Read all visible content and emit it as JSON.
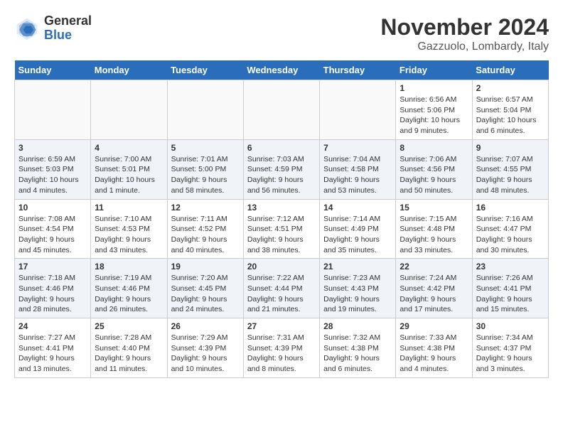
{
  "header": {
    "logo_general": "General",
    "logo_blue": "Blue",
    "month_title": "November 2024",
    "location": "Gazzuolo, Lombardy, Italy"
  },
  "weekdays": [
    "Sunday",
    "Monday",
    "Tuesday",
    "Wednesday",
    "Thursday",
    "Friday",
    "Saturday"
  ],
  "weeks": [
    [
      {
        "num": "",
        "info": ""
      },
      {
        "num": "",
        "info": ""
      },
      {
        "num": "",
        "info": ""
      },
      {
        "num": "",
        "info": ""
      },
      {
        "num": "",
        "info": ""
      },
      {
        "num": "1",
        "info": "Sunrise: 6:56 AM\nSunset: 5:06 PM\nDaylight: 10 hours and 9 minutes."
      },
      {
        "num": "2",
        "info": "Sunrise: 6:57 AM\nSunset: 5:04 PM\nDaylight: 10 hours and 6 minutes."
      }
    ],
    [
      {
        "num": "3",
        "info": "Sunrise: 6:59 AM\nSunset: 5:03 PM\nDaylight: 10 hours and 4 minutes."
      },
      {
        "num": "4",
        "info": "Sunrise: 7:00 AM\nSunset: 5:01 PM\nDaylight: 10 hours and 1 minute."
      },
      {
        "num": "5",
        "info": "Sunrise: 7:01 AM\nSunset: 5:00 PM\nDaylight: 9 hours and 58 minutes."
      },
      {
        "num": "6",
        "info": "Sunrise: 7:03 AM\nSunset: 4:59 PM\nDaylight: 9 hours and 56 minutes."
      },
      {
        "num": "7",
        "info": "Sunrise: 7:04 AM\nSunset: 4:58 PM\nDaylight: 9 hours and 53 minutes."
      },
      {
        "num": "8",
        "info": "Sunrise: 7:06 AM\nSunset: 4:56 PM\nDaylight: 9 hours and 50 minutes."
      },
      {
        "num": "9",
        "info": "Sunrise: 7:07 AM\nSunset: 4:55 PM\nDaylight: 9 hours and 48 minutes."
      }
    ],
    [
      {
        "num": "10",
        "info": "Sunrise: 7:08 AM\nSunset: 4:54 PM\nDaylight: 9 hours and 45 minutes."
      },
      {
        "num": "11",
        "info": "Sunrise: 7:10 AM\nSunset: 4:53 PM\nDaylight: 9 hours and 43 minutes."
      },
      {
        "num": "12",
        "info": "Sunrise: 7:11 AM\nSunset: 4:52 PM\nDaylight: 9 hours and 40 minutes."
      },
      {
        "num": "13",
        "info": "Sunrise: 7:12 AM\nSunset: 4:51 PM\nDaylight: 9 hours and 38 minutes."
      },
      {
        "num": "14",
        "info": "Sunrise: 7:14 AM\nSunset: 4:49 PM\nDaylight: 9 hours and 35 minutes."
      },
      {
        "num": "15",
        "info": "Sunrise: 7:15 AM\nSunset: 4:48 PM\nDaylight: 9 hours and 33 minutes."
      },
      {
        "num": "16",
        "info": "Sunrise: 7:16 AM\nSunset: 4:47 PM\nDaylight: 9 hours and 30 minutes."
      }
    ],
    [
      {
        "num": "17",
        "info": "Sunrise: 7:18 AM\nSunset: 4:46 PM\nDaylight: 9 hours and 28 minutes."
      },
      {
        "num": "18",
        "info": "Sunrise: 7:19 AM\nSunset: 4:46 PM\nDaylight: 9 hours and 26 minutes."
      },
      {
        "num": "19",
        "info": "Sunrise: 7:20 AM\nSunset: 4:45 PM\nDaylight: 9 hours and 24 minutes."
      },
      {
        "num": "20",
        "info": "Sunrise: 7:22 AM\nSunset: 4:44 PM\nDaylight: 9 hours and 21 minutes."
      },
      {
        "num": "21",
        "info": "Sunrise: 7:23 AM\nSunset: 4:43 PM\nDaylight: 9 hours and 19 minutes."
      },
      {
        "num": "22",
        "info": "Sunrise: 7:24 AM\nSunset: 4:42 PM\nDaylight: 9 hours and 17 minutes."
      },
      {
        "num": "23",
        "info": "Sunrise: 7:26 AM\nSunset: 4:41 PM\nDaylight: 9 hours and 15 minutes."
      }
    ],
    [
      {
        "num": "24",
        "info": "Sunrise: 7:27 AM\nSunset: 4:41 PM\nDaylight: 9 hours and 13 minutes."
      },
      {
        "num": "25",
        "info": "Sunrise: 7:28 AM\nSunset: 4:40 PM\nDaylight: 9 hours and 11 minutes."
      },
      {
        "num": "26",
        "info": "Sunrise: 7:29 AM\nSunset: 4:39 PM\nDaylight: 9 hours and 10 minutes."
      },
      {
        "num": "27",
        "info": "Sunrise: 7:31 AM\nSunset: 4:39 PM\nDaylight: 9 hours and 8 minutes."
      },
      {
        "num": "28",
        "info": "Sunrise: 7:32 AM\nSunset: 4:38 PM\nDaylight: 9 hours and 6 minutes."
      },
      {
        "num": "29",
        "info": "Sunrise: 7:33 AM\nSunset: 4:38 PM\nDaylight: 9 hours and 4 minutes."
      },
      {
        "num": "30",
        "info": "Sunrise: 7:34 AM\nSunset: 4:37 PM\nDaylight: 9 hours and 3 minutes."
      }
    ]
  ]
}
